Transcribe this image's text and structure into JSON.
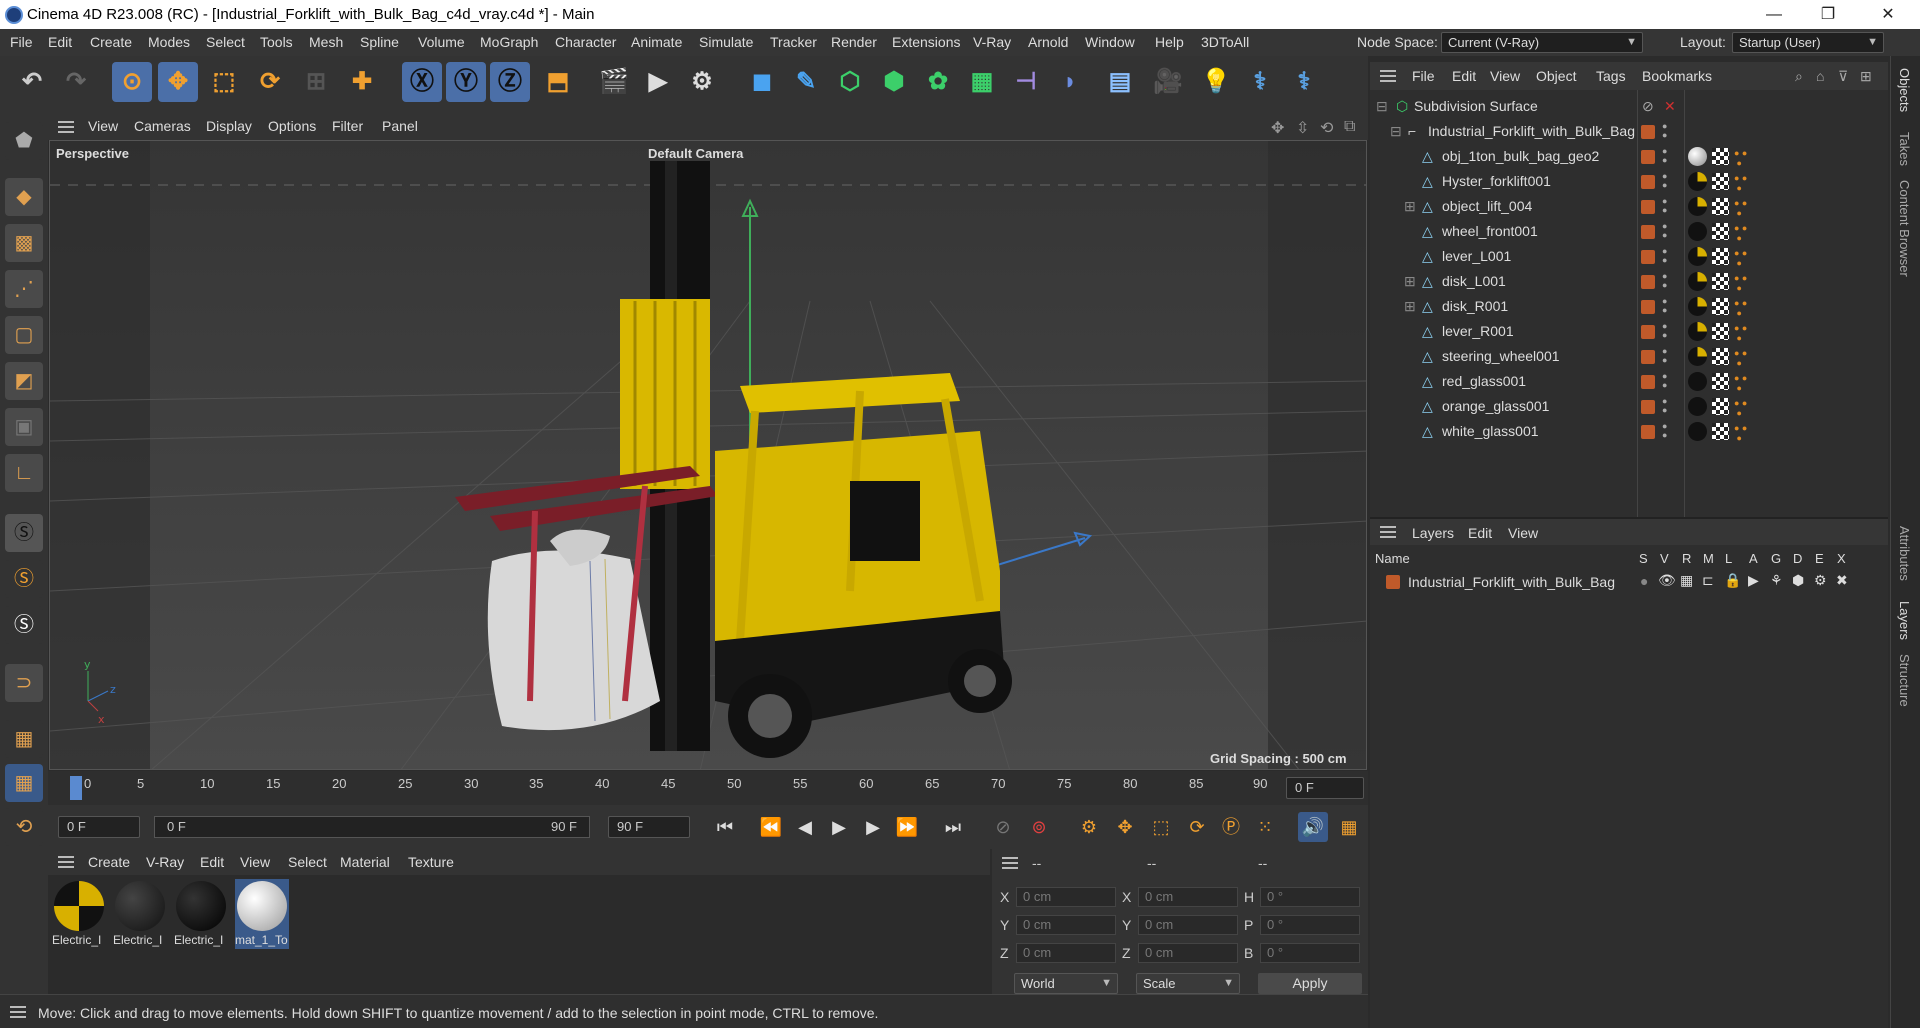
{
  "window": {
    "title": "Cinema 4D R23.008 (RC) - [Industrial_Forklift_with_Bulk_Bag_c4d_vray.c4d *] - Main",
    "minimize": "—",
    "maximize": "❐",
    "close": "✕"
  },
  "menu": [
    "File",
    "Edit",
    "Create",
    "Modes",
    "Select",
    "Tools",
    "Mesh",
    "Spline",
    "Volume",
    "MoGraph",
    "Character",
    "Animate",
    "Simulate",
    "Tracker",
    "Render",
    "Extensions",
    "V-Ray",
    "Arnold",
    "Window",
    "Help",
    "3DToAll"
  ],
  "node_space": {
    "label": "Node Space:",
    "value": "Current (V-Ray)"
  },
  "layout": {
    "label": "Layout:",
    "value": "Startup (User)"
  },
  "viewport": {
    "menu": [
      "View",
      "Cameras",
      "Display",
      "Options",
      "Filter",
      "Panel"
    ],
    "label": "Perspective",
    "camera": "Default Camera",
    "grid_spacing": "Grid Spacing : 500 cm"
  },
  "timeline": {
    "ticks": [
      "0",
      "5",
      "10",
      "15",
      "20",
      "25",
      "30",
      "35",
      "40",
      "45",
      "50",
      "55",
      "60",
      "65",
      "70",
      "75",
      "80",
      "85",
      "90"
    ],
    "current_frame": "0 F"
  },
  "time_controls": {
    "start": "0 F",
    "range_start": "0 F",
    "range_end": "90 F",
    "end": "90 F"
  },
  "material_panel": {
    "menu": [
      "Create",
      "V-Ray",
      "Edit",
      "View",
      "Select",
      "Material",
      "Texture"
    ],
    "materials": [
      {
        "label": "Electric_I"
      },
      {
        "label": "Electric_I"
      },
      {
        "label": "Electric_I"
      },
      {
        "label": "mat_1_To"
      }
    ]
  },
  "coords": {
    "headers": [
      "--",
      "--",
      "--"
    ],
    "rows": [
      {
        "a": "X",
        "av": "0 cm",
        "b": "X",
        "bv": "0 cm",
        "c": "H",
        "cv": "0 °"
      },
      {
        "a": "Y",
        "av": "0 cm",
        "b": "Y",
        "bv": "0 cm",
        "c": "P",
        "cv": "0 °"
      },
      {
        "a": "Z",
        "av": "0 cm",
        "b": "Z",
        "bv": "0 cm",
        "c": "B",
        "cv": "0 °"
      }
    ],
    "world": "World",
    "scale": "Scale",
    "apply": "Apply"
  },
  "status": "Move: Click and drag to move elements. Hold down SHIFT to quantize movement / add to the selection in point mode, CTRL to remove.",
  "objects_panel": {
    "menu": [
      "File",
      "Edit",
      "View",
      "Object",
      "Tags",
      "Bookmarks"
    ],
    "items": [
      {
        "name": "Subdivision Surface"
      },
      {
        "name": "Industrial_Forklift_with_Bulk_Bag"
      },
      {
        "name": "obj_1ton_bulk_bag_geo2"
      },
      {
        "name": "Hyster_forklift001"
      },
      {
        "name": "object_lift_004"
      },
      {
        "name": "wheel_front001"
      },
      {
        "name": "lever_L001"
      },
      {
        "name": "disk_L001"
      },
      {
        "name": "disk_R001"
      },
      {
        "name": "lever_R001"
      },
      {
        "name": "steering_wheel001"
      },
      {
        "name": "red_glass001"
      },
      {
        "name": "orange_glass001"
      },
      {
        "name": "white_glass001"
      }
    ]
  },
  "layers_panel": {
    "menu": [
      "Layers",
      "Edit",
      "View"
    ],
    "header_name": "Name",
    "header_cols": [
      "S",
      "V",
      "R",
      "M",
      "L",
      "A",
      "G",
      "D",
      "E",
      "X"
    ],
    "layer": "Industrial_Forklift_with_Bulk_Bag"
  },
  "side_tabs": [
    "Objects",
    "Takes",
    "Content Browser",
    "Attributes",
    "Layers",
    "Structure"
  ]
}
